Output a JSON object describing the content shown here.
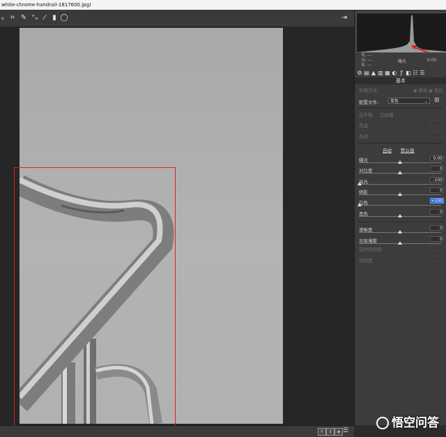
{
  "window": {
    "title": "white-chrome-handrail-1817600.jpg)"
  },
  "toolbar": {
    "tools": [
      "zoom-icon",
      "crop-icon",
      "retouch-icon",
      "redeye-icon",
      "brush-icon",
      "gradient-icon",
      "radial-icon"
    ],
    "export_icon": "export-icon"
  },
  "histogram": {
    "labels": {
      "r": "R:",
      "g": "G:",
      "b": "B:",
      "r_val": "---",
      "g_val": "---",
      "b_val": "---"
    },
    "exposure_label": "曝光",
    "exposure_value": "0.00"
  },
  "panel": {
    "section_title": "基本",
    "treatment": {
      "label": "处理方式:",
      "opt_color": "颜色",
      "opt_bw": "黑白"
    },
    "profile": {
      "label": "配置文件:",
      "value": "单色"
    },
    "wb": {
      "label": "白平衡:",
      "value": "已拍摄"
    },
    "temp_label": "色温",
    "tint_label": "色调",
    "auto_label": "自动",
    "default_label": "默认值",
    "sliders": [
      {
        "label": "曝光",
        "value": "0.00",
        "level": 0.5,
        "active": false
      },
      {
        "label": "对比度",
        "value": "0",
        "level": 0.5,
        "active": false
      },
      {
        "label": "高光",
        "value": "-100",
        "level": 0.0,
        "active": false
      },
      {
        "label": "阴影",
        "value": "0",
        "level": 0.5,
        "active": false
      },
      {
        "label": "白色",
        "value": "+100",
        "level": 0.0,
        "active": true
      },
      {
        "label": "黑色",
        "value": "0",
        "level": 0.5,
        "active": false
      }
    ],
    "presence": [
      {
        "label": "清晰度",
        "value": "0",
        "level": 0.5
      },
      {
        "label": "去除薄雾",
        "value": "0",
        "level": 0.5
      }
    ],
    "vibrance_label": "自然饱和度",
    "saturation_label": "饱和度"
  },
  "statusbar": {
    "buttons": [
      "Y",
      "↕",
      "◈"
    ]
  },
  "watermark": {
    "text": "悟空问答"
  }
}
